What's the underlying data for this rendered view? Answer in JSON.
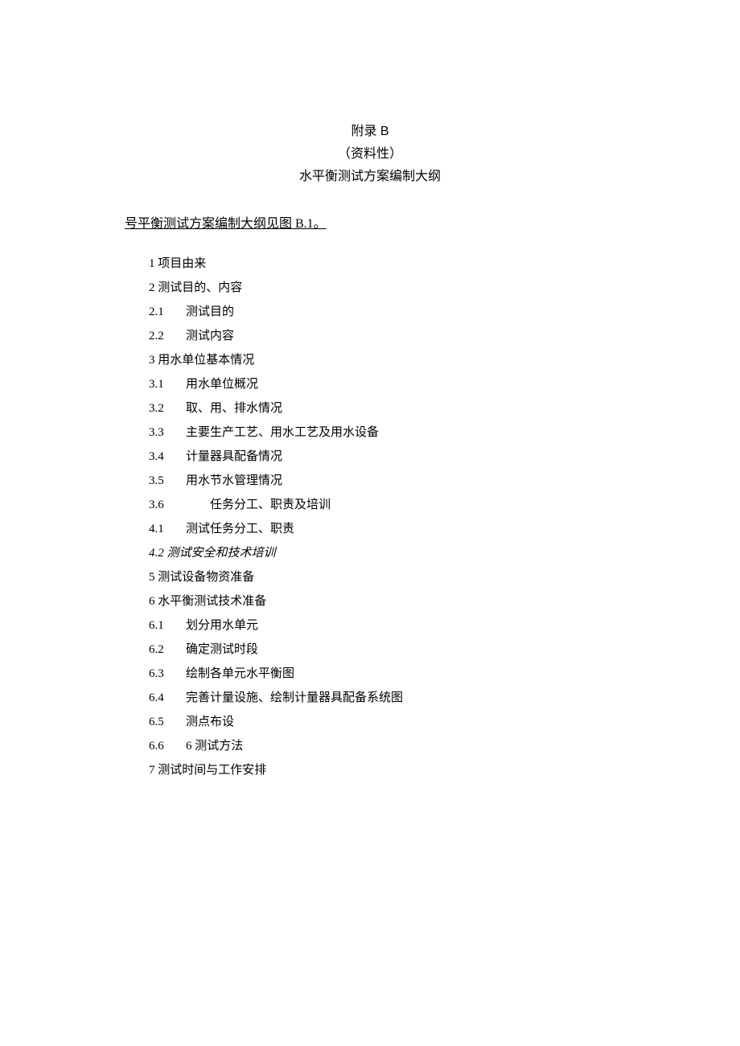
{
  "header": {
    "line1": "附录 B",
    "line2": "（资料性）",
    "line3": "水平衡测试方案编制大纲"
  },
  "intro": "号平衡测试方案编制大纲见图 B.1。",
  "outline": [
    {
      "num": "1",
      "text": "项目由来",
      "style": "tight"
    },
    {
      "num": "2",
      "text": "测试目的、内容",
      "style": "tight"
    },
    {
      "num": "2.1",
      "text": "测试目的",
      "style": "normal"
    },
    {
      "num": "2.2",
      "text": "测试内容",
      "style": "normal"
    },
    {
      "num": "3",
      "text": "用水单位基本情况",
      "style": "tight"
    },
    {
      "num": "3.1",
      "text": "用水单位概况",
      "style": "normal"
    },
    {
      "num": "3.2",
      "text": "取、用、排水情况",
      "style": "normal"
    },
    {
      "num": "3.3",
      "text": "主要生产工艺、用水工艺及用水设备",
      "style": "normal"
    },
    {
      "num": "3.4",
      "text": "计量器具配备情况",
      "style": "normal"
    },
    {
      "num": "3.5",
      "text": "用水节水管理情况",
      "style": "normal"
    },
    {
      "num": "3.6",
      "text": "任务分工、职责及培训",
      "style": "wide"
    },
    {
      "num": "4.1",
      "text": "测试任务分工、职责",
      "style": "normal"
    },
    {
      "num": "4.2",
      "text": "测试安全和技术培训",
      "style": "italic-tight"
    },
    {
      "num": "5",
      "text": "测试设备物资准备",
      "style": "tight"
    },
    {
      "num": "6",
      "text": "水平衡测试技术准备",
      "style": "tight"
    },
    {
      "num": "6.1",
      "text": "划分用水单元",
      "style": "normal"
    },
    {
      "num": "6.2",
      "text": "确定测试时段",
      "style": "normal"
    },
    {
      "num": "6.3",
      "text": "绘制各单元水平衡图",
      "style": "normal"
    },
    {
      "num": "6.4",
      "text": "完善计量设施、绘制计量器具配备系统图",
      "style": "normal"
    },
    {
      "num": "6.5",
      "text": "测点布设",
      "style": "normal"
    },
    {
      "num": "6.6",
      "text": "6 测试方法",
      "style": "normal"
    },
    {
      "num": "7",
      "text": "测试时间与工作安排",
      "style": "tight"
    }
  ]
}
